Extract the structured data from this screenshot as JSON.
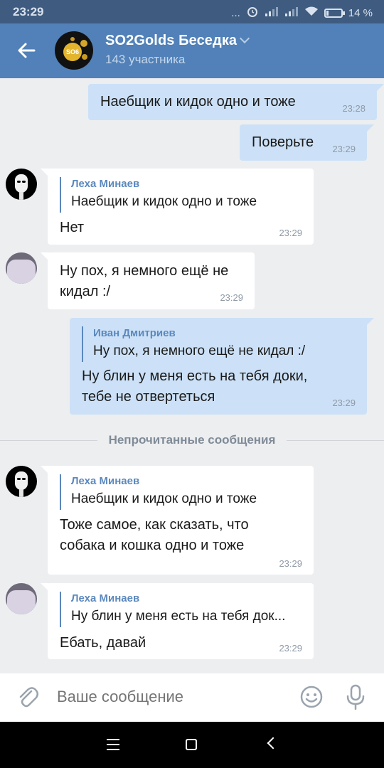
{
  "status_bar": {
    "time": "23:29",
    "dots": "...",
    "battery_percent": "14 %",
    "battery_level": 0.14
  },
  "header": {
    "title": "SO2Golds Беседка",
    "subtitle": "143 участника",
    "avatar_text": "SO6"
  },
  "messages": [
    {
      "text": "Наебщик и кидок одно и тоже",
      "time": "23:28"
    },
    {
      "text": "Поверьте",
      "time": "23:29"
    },
    {
      "quote_author": "Леха Минаев",
      "quote_text": "Наебщик и кидок одно и тоже",
      "text": "Нет",
      "time": "23:29"
    },
    {
      "text_line1": "Ну пох, я немного ещё не",
      "text_line2": "кидал :/",
      "time": "23:29"
    },
    {
      "quote_author": "Иван Дмитриев",
      "quote_text": "Ну пох, я немного ещё не кидал :/",
      "text_line1": "Ну блин у меня есть на тебя доки,",
      "text_line2": "тебе не отвертеться",
      "time": "23:29"
    },
    {
      "quote_author": "Леха Минаев",
      "quote_text": "Наебщик и кидок одно и тоже",
      "text_line1": "Тоже самое, как сказать, что",
      "text_line2": "собака и кошка одно и тоже",
      "time": "23:29"
    },
    {
      "quote_author": "Леха Минаев",
      "quote_text": "Ну блин у меня есть на тебя док...",
      "text": "Ебать, давай",
      "time": "23:29"
    }
  ],
  "divider": {
    "label": "Непрочитанные сообщения"
  },
  "input": {
    "placeholder": "Ваше сообщение"
  },
  "colors": {
    "header": "#5181b8",
    "status_bar": "#3f5c80",
    "outgoing_bubble": "#cce1f7",
    "incoming_bubble": "#ffffff",
    "background": "#edeef0",
    "accent": "#5b88bd"
  },
  "icons": [
    "back-arrow-icon",
    "chevron-down-icon",
    "attach-icon",
    "smile-icon",
    "mic-icon",
    "nav-menu-icon",
    "nav-home-icon",
    "nav-back-icon"
  ]
}
